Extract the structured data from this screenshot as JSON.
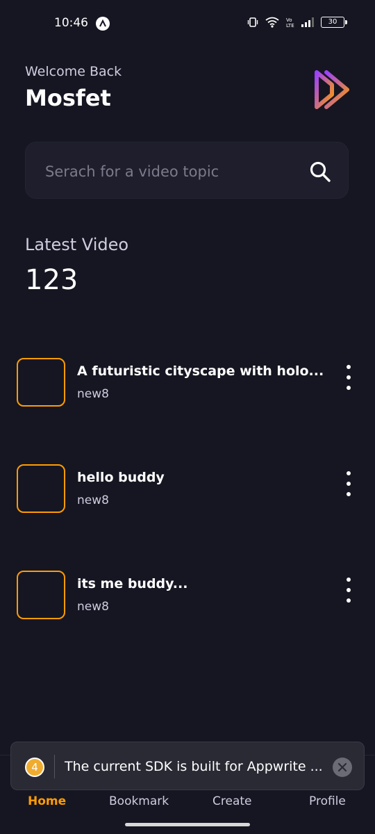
{
  "status_bar": {
    "time": "10:46",
    "battery": "30"
  },
  "header": {
    "welcome": "Welcome Back",
    "username": "Mosfet"
  },
  "search": {
    "placeholder": "Serach for a video topic"
  },
  "latest": {
    "label": "Latest Video",
    "count": "123"
  },
  "videos": [
    {
      "title": "A futuristic cityscape with holo...",
      "author": "new8"
    },
    {
      "title": "hello buddy",
      "author": "new8"
    },
    {
      "title": "its me buddy...",
      "author": "new8"
    }
  ],
  "tabs": [
    {
      "label": "Home",
      "active": true
    },
    {
      "label": "Bookmark",
      "active": false
    },
    {
      "label": "Create",
      "active": false
    },
    {
      "label": "Profile",
      "active": false
    }
  ],
  "toast": {
    "count": "4",
    "message": "The current SDK is built for Appwrite ..."
  },
  "colors": {
    "background": "#161622",
    "accent": "#ff9c01",
    "logo_gradient": [
      "#9b40ff",
      "#ff9c01"
    ]
  }
}
